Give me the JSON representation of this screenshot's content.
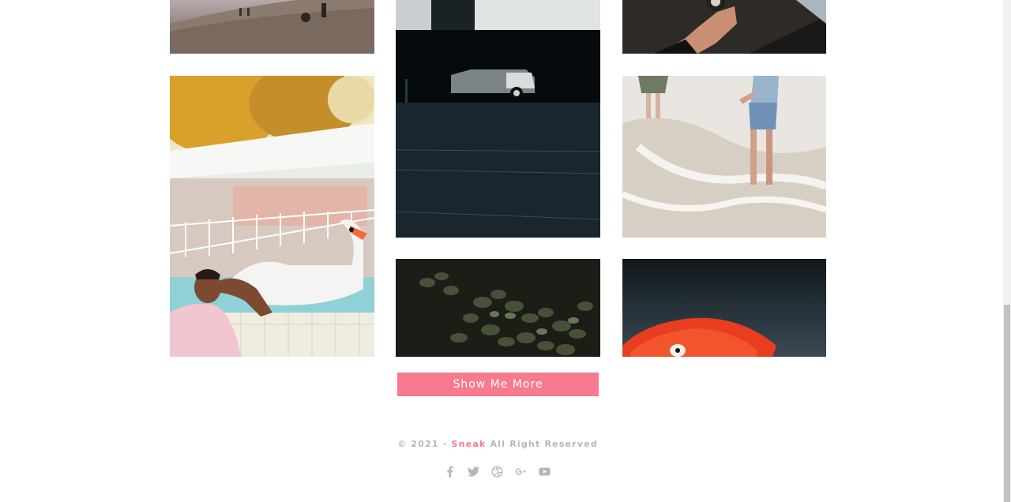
{
  "gallery": {
    "photos": [
      {
        "subject": "beach-people"
      },
      {
        "subject": "parking-garage-car"
      },
      {
        "subject": "hand-holding-compass"
      },
      {
        "subject": "man-by-pool-with-swan-float"
      },
      {
        "subject": "people-walking-in-waves"
      },
      {
        "subject": "green-leaves"
      },
      {
        "subject": "red-parrot"
      }
    ]
  },
  "actions": {
    "show_more": "Show Me More"
  },
  "footer": {
    "copyright_prefix": "© 2021 - ",
    "brand": "Sneak",
    "copyright_suffix": " All Right Reserved",
    "socials": [
      "facebook-icon",
      "twitter-icon",
      "dribbble-icon",
      "google-plus-icon",
      "youtube-icon"
    ]
  },
  "colors": {
    "accent": "#f87a8e",
    "muted": "#b4b7bf"
  }
}
